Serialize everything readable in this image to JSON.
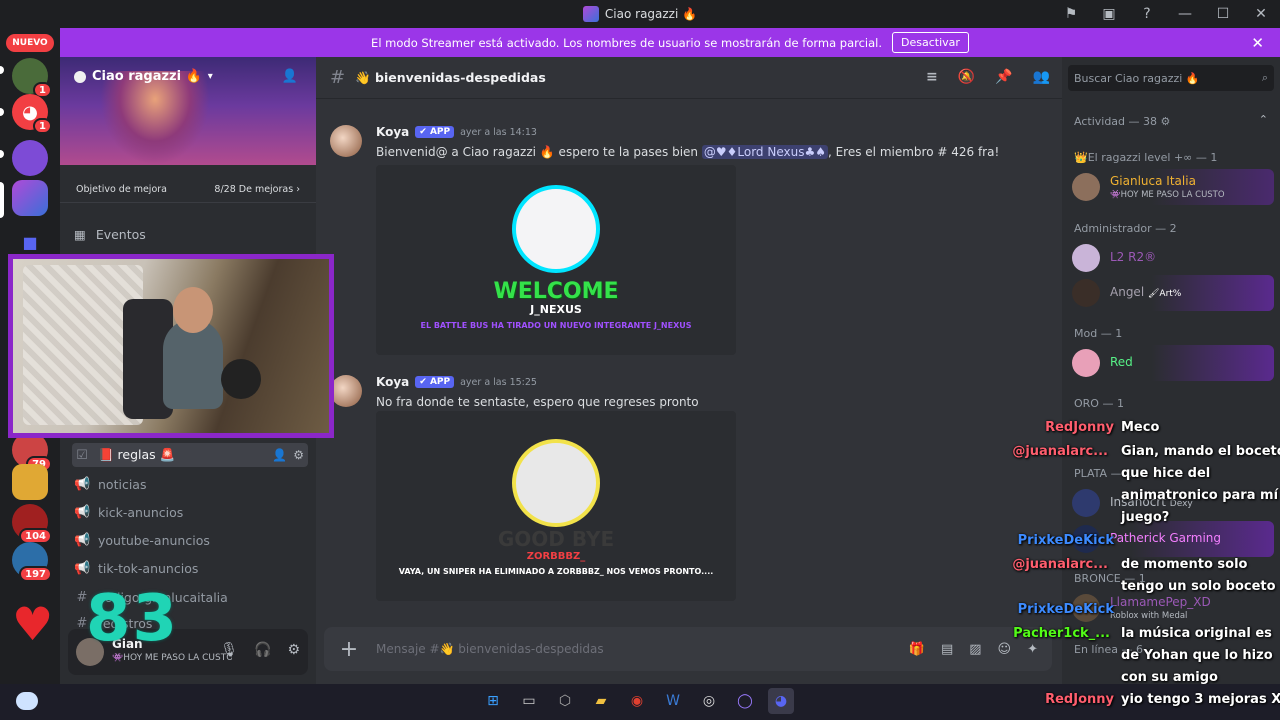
{
  "window": {
    "title": "Ciao ragazzi 🔥"
  },
  "banner": {
    "text": "El modo Streamer está activado. Los nombres de usuario se mostrarán de forma parcial.",
    "button": "Desactivar"
  },
  "rail": {
    "new_label": "NUEVO",
    "badges": [
      "1",
      "1",
      "79",
      "104",
      "197"
    ]
  },
  "server": {
    "name": "Ciao ragazzi 🔥",
    "boost_goal": "Objetivo de mejora",
    "boost_progress": "8/28 De mejoras",
    "boost_progress_fraction": 0.2857,
    "events": "Eventos"
  },
  "channels": [
    {
      "name": "📕 reglas 🚨",
      "type": "rules"
    },
    {
      "name": "noticias",
      "type": "announce"
    },
    {
      "name": "kick-anuncios",
      "type": "announce"
    },
    {
      "name": "youtube-anuncios",
      "type": "announce"
    },
    {
      "name": "tik-tok-anuncios",
      "type": "announce"
    },
    {
      "name": "codigo-gianlucaitalia",
      "type": "text"
    },
    {
      "name": "registros",
      "type": "text"
    }
  ],
  "user_panel": {
    "name": "Gian",
    "status": "👾HOY ME PASO LA CUSTO..."
  },
  "chat": {
    "channel": "👋 bienvenidas-despedidas",
    "composer_placeholder": "Mensaje #👋 bienvenidas-despedidas",
    "messages": [
      {
        "user": "Koya",
        "tag": "✔ APP",
        "time": "ayer a las 14:13",
        "text_before": "Bienvenid@ a Ciao ragazzi 🔥 espero te la pases bien ",
        "mention": "@♥♦Lord Nexus♣♠",
        "text_after": ", Eres el miembro # 426 fra!",
        "embed": {
          "title": "WELCOME",
          "name": "J_NEXUS",
          "caption": "EL BATTLE BUS HA TIRADO UN NUEVO INTEGRANTE J_NEXUS"
        }
      },
      {
        "user": "Koya",
        "tag": "✔ APP",
        "time": "ayer a las 15:25",
        "text": "No fra donde te sentaste, espero que regreses pronto",
        "embed": {
          "title": "GOOD BYE",
          "name": "ZORBBBZ_",
          "caption": "VAYA, UN SNIPER HA ELIMINADO A ZORBBBZ_ NOS VEMOS PRONTO...."
        }
      }
    ]
  },
  "members": {
    "search_placeholder": "Buscar Ciao ragazzi 🔥",
    "activity": "Actividad — 38",
    "groups": [
      {
        "label": "👑El ragazzi level +∞ — 1"
      },
      {
        "label": "Administrador — 2"
      },
      {
        "label": "Mod — 1"
      },
      {
        "label": "ORO — 1"
      },
      {
        "label": "PLATA — 1"
      },
      {
        "label": "BRONCE — 1"
      },
      {
        "label": "En línea — 6"
      }
    ],
    "entries": [
      {
        "name": "Gianluca Italia",
        "sub": "👾HOY ME PASO LA CUSTO",
        "color": "#f0b232"
      },
      {
        "name": "L2 R2®",
        "sub": "",
        "color": "#9b59b6"
      },
      {
        "name": "Angel",
        "sub": "🖌Art%",
        "color": "#a5a0ad"
      },
      {
        "name": "Red",
        "sub": "",
        "color": "#57f287"
      },
      {
        "name": "Insanocrt",
        "sub": "Dexy",
        "color": "#b5bac1"
      },
      {
        "name": "Patherick Garming",
        "sub": "",
        "color": "#f47fff"
      },
      {
        "name": "LlamamePep_XD",
        "sub": "Roblox with Medal",
        "color": "#9b59b6"
      }
    ]
  },
  "overlay": {
    "counter": "83",
    "chat": [
      {
        "user": "RedJonny",
        "user_color": "#ff5e6e",
        "text": "Meco"
      },
      {
        "user": "@juanalarc...",
        "user_color": "#ff5e6e",
        "text": "Gian, mando el boceto"
      },
      {
        "user": "",
        "user_color": "",
        "text": "que hice del"
      },
      {
        "user": "",
        "user_color": "",
        "text": "animatronico para mí"
      },
      {
        "user": "",
        "user_color": "",
        "text": "juego?"
      },
      {
        "user": "PrixkeDeKick",
        "user_color": "#3d8bff",
        "text": ""
      },
      {
        "user": "@juanalarc...",
        "user_color": "#ff5e6e",
        "text": "de momento solo"
      },
      {
        "user": "",
        "user_color": "",
        "text": "tengo un solo boceto"
      },
      {
        "user": "PrixkeDeKick",
        "user_color": "#3d8bff",
        "text": ""
      },
      {
        "user": "Pacher1ck_...",
        "user_color": "#53fc18",
        "text": "la música original es"
      },
      {
        "user": "",
        "user_color": "",
        "text": "de Yohan que lo hizo"
      },
      {
        "user": "",
        "user_color": "",
        "text": "con su amigo"
      },
      {
        "user": "RedJonny",
        "user_color": "#ff5e6e",
        "text": "yio tengo 3 mejoras Xd"
      }
    ]
  }
}
